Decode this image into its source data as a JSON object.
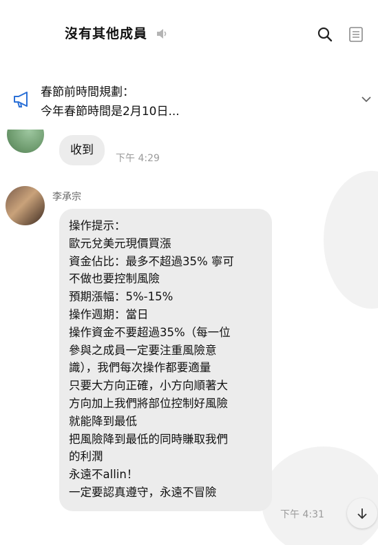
{
  "header": {
    "title": "沒有其他成員"
  },
  "announcement": {
    "title": "春節前時間規劃：",
    "body": "今年春節時間是2月10日..."
  },
  "messages": [
    {
      "text": "收到",
      "time": "下午 4:29"
    },
    {
      "sender": "李承宗",
      "lines": [
        "操作提示：",
        "歐元兌美元現價買漲",
        "資金佔比：最多不超過35% 寧可",
        "不做也要控制風險",
        "預期漲幅：5%-15%",
        "操作週期：當日",
        "操作資金不要超過35%（每一位",
        "參與之成員一定要注重風險意",
        "識），我們每次操作都要適量",
        "只要大方向正確，小方向順著大",
        "方向加上我們將部位控制好風險",
        "就能降到最低",
        "把風險降到最低的同時賺取我們",
        "的利潤",
        "永遠不allin！",
        "一定要認真遵守，永遠不冒險"
      ],
      "time": "下午 4:31"
    }
  ],
  "icons": {
    "mute": "speaker-muted-icon",
    "search": "search-icon",
    "notes": "notes-icon",
    "announcement": "megaphone-icon",
    "expand": "chevron-down-icon",
    "scroll": "arrow-down-icon"
  }
}
